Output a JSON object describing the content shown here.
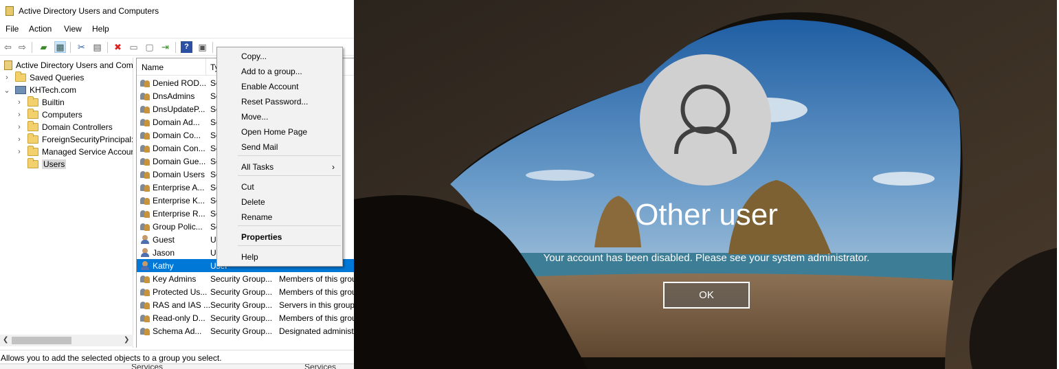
{
  "aduc": {
    "title": "Active Directory Users and Computers",
    "menu": [
      "File",
      "Action",
      "View",
      "Help"
    ],
    "toolbar_icons": [
      "back-arrow-icon",
      "forward-arrow-icon",
      "up-folder-icon",
      "show-pane-icon",
      "cut-icon",
      "copy-icon",
      "delete-icon",
      "properties-icon",
      "refresh-icon",
      "export-icon",
      "help-icon",
      "console-icon",
      "add-user-icon",
      "add-group-icon",
      "add-ou-icon",
      "filter-icon",
      "find-icon",
      "add-to-group-icon"
    ],
    "tree": [
      {
        "label": "Active Directory Users and Com",
        "icon": "book"
      },
      {
        "label": "Saved Queries",
        "icon": "folder",
        "toggle": "›"
      },
      {
        "label": "KHTech.com",
        "icon": "domain",
        "toggle": "⌄"
      },
      {
        "label": "Builtin",
        "icon": "folder",
        "toggle": "›"
      },
      {
        "label": "Computers",
        "icon": "folder",
        "toggle": "›"
      },
      {
        "label": "Domain Controllers",
        "icon": "folder",
        "toggle": "›"
      },
      {
        "label": "ForeignSecurityPrincipal:",
        "icon": "folder",
        "toggle": "›"
      },
      {
        "label": "Managed Service Accour",
        "icon": "folder",
        "toggle": "›"
      },
      {
        "label": "Users",
        "icon": "folder",
        "toggle": ""
      }
    ],
    "columns": [
      "Name",
      "Ty"
    ],
    "rows": [
      {
        "name": "Denied ROD...",
        "type": "Se",
        "desc": "rs"
      },
      {
        "name": "DnsAdmins",
        "type": "Se",
        "desc": "rs"
      },
      {
        "name": "DnsUpdateP...",
        "type": "Se",
        "desc": "re"
      },
      {
        "name": "Domain Ad...",
        "type": "Se",
        "desc": "nis"
      },
      {
        "name": "Domain Co...",
        "type": "Se",
        "desc": "nd"
      },
      {
        "name": "Domain Con...",
        "type": "Se",
        "desc": "olle"
      },
      {
        "name": "Domain Gue...",
        "type": "Se",
        "desc": ""
      },
      {
        "name": "Domain Users",
        "type": "Se",
        "desc": ""
      },
      {
        "name": "Enterprise A...",
        "type": "Se",
        "desc": "nist"
      },
      {
        "name": "Enterprise K...",
        "type": "Se",
        "desc": "rou"
      },
      {
        "name": "Enterprise R...",
        "type": "Se",
        "desc": "grou"
      },
      {
        "name": "Group Polic...",
        "type": "Se",
        "desc": "rou"
      },
      {
        "name": "Guest",
        "type": "Us",
        "desc": "or g"
      },
      {
        "name": "Jason",
        "type": "Us",
        "desc": ""
      },
      {
        "name": "Kathy",
        "type": "User",
        "desc": ""
      },
      {
        "name": "Key Admins",
        "type": "Security Group...",
        "desc": "Members of this grou"
      },
      {
        "name": "Protected Us...",
        "type": "Security Group...",
        "desc": "Members of this grou"
      },
      {
        "name": "RAS and IAS ...",
        "type": "Security Group...",
        "desc": "Servers in this group"
      },
      {
        "name": "Read-only D...",
        "type": "Security Group...",
        "desc": "Members of this grou"
      },
      {
        "name": "Schema Ad...",
        "type": "Security Group...",
        "desc": "Designated administ"
      }
    ],
    "status": "Allows you to add the selected objects to a group you select.",
    "bottom_strip": [
      "Services",
      "Services"
    ]
  },
  "context_menu": {
    "items": [
      {
        "label": "Copy...",
        "kind": "item"
      },
      {
        "label": "Add to a group...",
        "kind": "item"
      },
      {
        "label": "Enable Account",
        "kind": "item"
      },
      {
        "label": "Reset Password...",
        "kind": "item"
      },
      {
        "label": "Move...",
        "kind": "item"
      },
      {
        "label": "Open Home Page",
        "kind": "item"
      },
      {
        "label": "Send Mail",
        "kind": "item"
      },
      {
        "label": "All Tasks",
        "kind": "submenu"
      },
      {
        "label": "Cut",
        "kind": "item"
      },
      {
        "label": "Delete",
        "kind": "item"
      },
      {
        "label": "Rename",
        "kind": "item"
      },
      {
        "label": "Properties",
        "kind": "bold"
      },
      {
        "label": "Help",
        "kind": "item"
      }
    ]
  },
  "lockscreen": {
    "username": "Other user",
    "message": "Your account has been disabled.  Please see your system administrator.",
    "ok_label": "OK"
  },
  "colors": {
    "selection": "#0078d7",
    "menu_bg": "#f2f2f2",
    "avatar": "#d0d0d0"
  }
}
